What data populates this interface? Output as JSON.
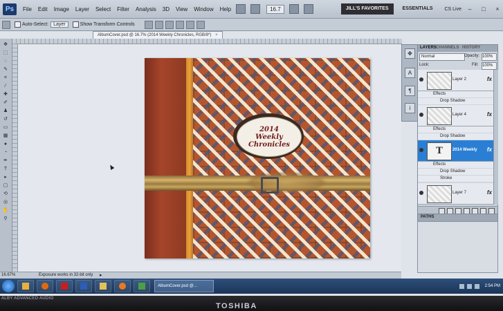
{
  "app": {
    "logo": "Ps",
    "menu": [
      "File",
      "Edit",
      "Image",
      "Layer",
      "Select",
      "Filter",
      "Analysis",
      "3D",
      "View",
      "Window",
      "Help"
    ],
    "zoom_select": "16.7",
    "workspace_favorites": "JILL'S FAVORITES",
    "workspace_essentials": "ESSENTIALS",
    "cs_live": "CS Live"
  },
  "options": {
    "auto_select": "Auto-Select:",
    "auto_select_value": "Layer",
    "show_transform": "Show Transform Controls"
  },
  "document": {
    "tab_title": "AlbumCover.psd @ 16.7% (2014 Weekly  Chronicles, RGB/8*)",
    "close": "×",
    "label_lines": [
      "2014",
      "Weekly",
      "Chronicles"
    ]
  },
  "layers": {
    "tabs": [
      "LAYERS",
      "CHANNELS",
      "HISTORY"
    ],
    "blend_mode": "Normal",
    "opacity_label": "Opacity:",
    "opacity_value": "100%",
    "lock_label": "Lock:",
    "fill_label": "Fill:",
    "fill_value": "100%",
    "items": [
      {
        "name": "Layer 2",
        "fx": "fx",
        "effects_label": "Effects",
        "effects": [
          "Drop Shadow"
        ]
      },
      {
        "name": "Layer 4",
        "fx": "fx",
        "effects_label": "Effects",
        "effects": [
          "Drop Shadow"
        ]
      },
      {
        "name": "2014 Weekly",
        "fx": "fx",
        "thumb": "T",
        "effects_label": "Effects",
        "effects": [
          "Drop Shadow",
          "Stroke"
        ]
      },
      {
        "name": "Layer 7",
        "fx": "fx"
      }
    ],
    "paths_tab": "PATHS"
  },
  "status": {
    "zoom": "16.67%",
    "message": "Exposure works in 32-bit only"
  },
  "taskbar": {
    "ps_task": "AlbumCover.psd @...",
    "clock": "2:54 PM"
  },
  "bezel": {
    "audio": "ALBY ADVANCED AUDIO",
    "brand": "TOSHIBA"
  },
  "colors": {
    "foreground": "#7a1a12",
    "background": "#ffffff",
    "selected_layer": "#2a7fd4"
  }
}
